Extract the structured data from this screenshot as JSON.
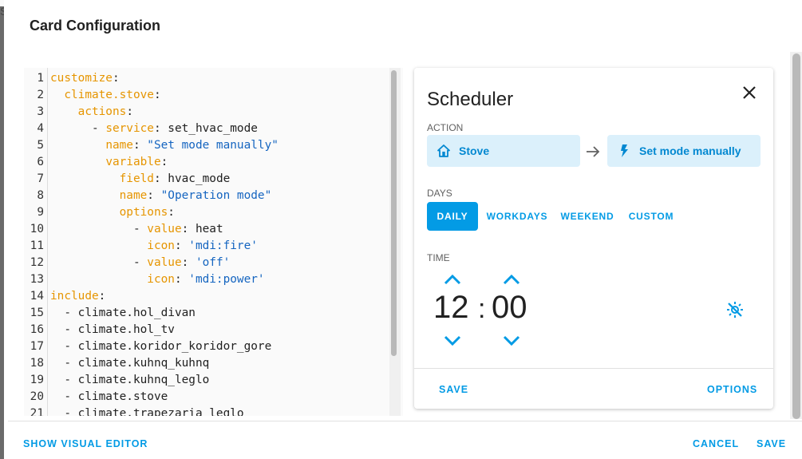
{
  "background": {
    "partial_text": "S"
  },
  "dialog": {
    "title": "Card Configuration",
    "show_visual_editor_label": "SHOW VISUAL EDITOR",
    "cancel_label": "CANCEL",
    "save_label": "SAVE"
  },
  "editor": {
    "lines": [
      {
        "n": "1",
        "indent": 0,
        "key": "customize",
        "sep": ":",
        "val": "",
        "vtype": ""
      },
      {
        "n": "2",
        "indent": 2,
        "key": "climate.stove",
        "sep": ":",
        "val": "",
        "vtype": ""
      },
      {
        "n": "3",
        "indent": 4,
        "key": "actions",
        "sep": ":",
        "val": "",
        "vtype": ""
      },
      {
        "n": "4",
        "indent": 6,
        "dash": true,
        "key": "service",
        "sep": ": ",
        "val": "set_hvac_mode",
        "vtype": "plain"
      },
      {
        "n": "5",
        "indent": 8,
        "key": "name",
        "sep": ": ",
        "val": "\"Set mode manually\"",
        "vtype": "str"
      },
      {
        "n": "6",
        "indent": 8,
        "key": "variable",
        "sep": ":",
        "val": "",
        "vtype": ""
      },
      {
        "n": "7",
        "indent": 10,
        "key": "field",
        "sep": ": ",
        "val": "hvac_mode",
        "vtype": "plain"
      },
      {
        "n": "8",
        "indent": 10,
        "key": "name",
        "sep": ": ",
        "val": "\"Operation mode\"",
        "vtype": "str"
      },
      {
        "n": "9",
        "indent": 10,
        "key": "options",
        "sep": ":",
        "val": "",
        "vtype": ""
      },
      {
        "n": "10",
        "indent": 12,
        "dash": true,
        "key": "value",
        "sep": ": ",
        "val": "heat",
        "vtype": "plain"
      },
      {
        "n": "11",
        "indent": 14,
        "key": "icon",
        "sep": ": ",
        "val": "'mdi:fire'",
        "vtype": "str"
      },
      {
        "n": "12",
        "indent": 12,
        "dash": true,
        "key": "value",
        "sep": ": ",
        "val": "'off'",
        "vtype": "str"
      },
      {
        "n": "13",
        "indent": 14,
        "key": "icon",
        "sep": ": ",
        "val": "'mdi:power'",
        "vtype": "str"
      },
      {
        "n": "14",
        "indent": 0,
        "key": "include",
        "sep": ":",
        "val": "",
        "vtype": ""
      },
      {
        "n": "15",
        "indent": 2,
        "dash": true,
        "key": "",
        "sep": "",
        "val": "climate.hol_divan",
        "vtype": "plain"
      },
      {
        "n": "16",
        "indent": 2,
        "dash": true,
        "key": "",
        "sep": "",
        "val": "climate.hol_tv",
        "vtype": "plain"
      },
      {
        "n": "17",
        "indent": 2,
        "dash": true,
        "key": "",
        "sep": "",
        "val": "climate.koridor_koridor_gore",
        "vtype": "plain"
      },
      {
        "n": "18",
        "indent": 2,
        "dash": true,
        "key": "",
        "sep": "",
        "val": "climate.kuhnq_kuhnq",
        "vtype": "plain"
      },
      {
        "n": "19",
        "indent": 2,
        "dash": true,
        "key": "",
        "sep": "",
        "val": "climate.kuhnq_leglo",
        "vtype": "plain"
      },
      {
        "n": "20",
        "indent": 2,
        "dash": true,
        "key": "",
        "sep": "",
        "val": "climate.stove",
        "vtype": "plain"
      },
      {
        "n": "21",
        "indent": 2,
        "dash": true,
        "key": "",
        "sep": "",
        "val": "climate.trapezaria_leglo",
        "vtype": "plain"
      }
    ]
  },
  "card": {
    "title": "Scheduler",
    "action_label": "ACTION",
    "entity_label": "Stove",
    "entity_icon": "home-outline-icon",
    "service_label": "Set mode manually",
    "service_icon": "flash-icon",
    "days_label": "DAYS",
    "days": [
      "DAILY",
      "WORKDAYS",
      "WEEKEND",
      "CUSTOM"
    ],
    "active_day": "DAILY",
    "time_label": "TIME",
    "hour": "12",
    "separator": ":",
    "minute": "00",
    "save_label": "SAVE",
    "options_label": "OPTIONS"
  },
  "colors": {
    "accent": "#039be5",
    "chip_bg": "#dbf0fb",
    "yaml_key": "#e69500",
    "yaml_string": "#1565c0"
  }
}
